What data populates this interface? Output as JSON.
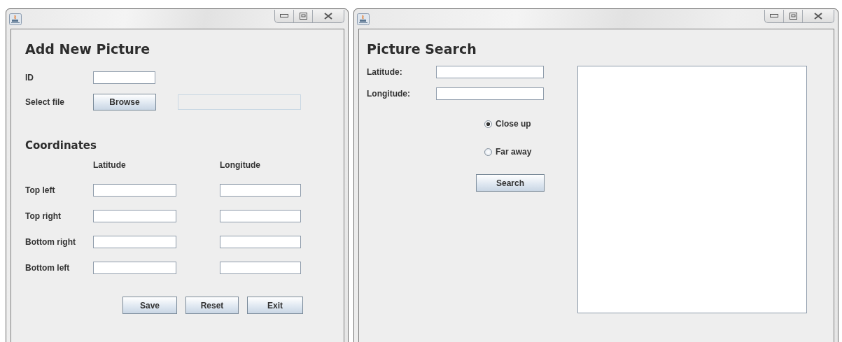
{
  "add_window": {
    "heading": "Add New Picture",
    "id_label": "ID",
    "file_label": "Select file",
    "browse_button": "Browse",
    "file_path": {
      "disabled": true
    },
    "coordinates_heading": "Coordinates",
    "columns": [
      "Latitude",
      "Longitude"
    ],
    "rows": [
      {
        "label": "Top left"
      },
      {
        "label": "Top right"
      },
      {
        "label": "Bottom right"
      },
      {
        "label": "Bottom left"
      }
    ],
    "buttons": [
      "Save",
      "Reset",
      "Exit"
    ]
  },
  "search_window": {
    "heading": "Picture Search",
    "fields": [
      {
        "label": "Latitude:"
      },
      {
        "label": "Longitude:"
      }
    ],
    "options": [
      {
        "label": "Close up",
        "selected": true
      },
      {
        "label": "Far away",
        "selected": false
      }
    ],
    "search_button": "Search"
  }
}
